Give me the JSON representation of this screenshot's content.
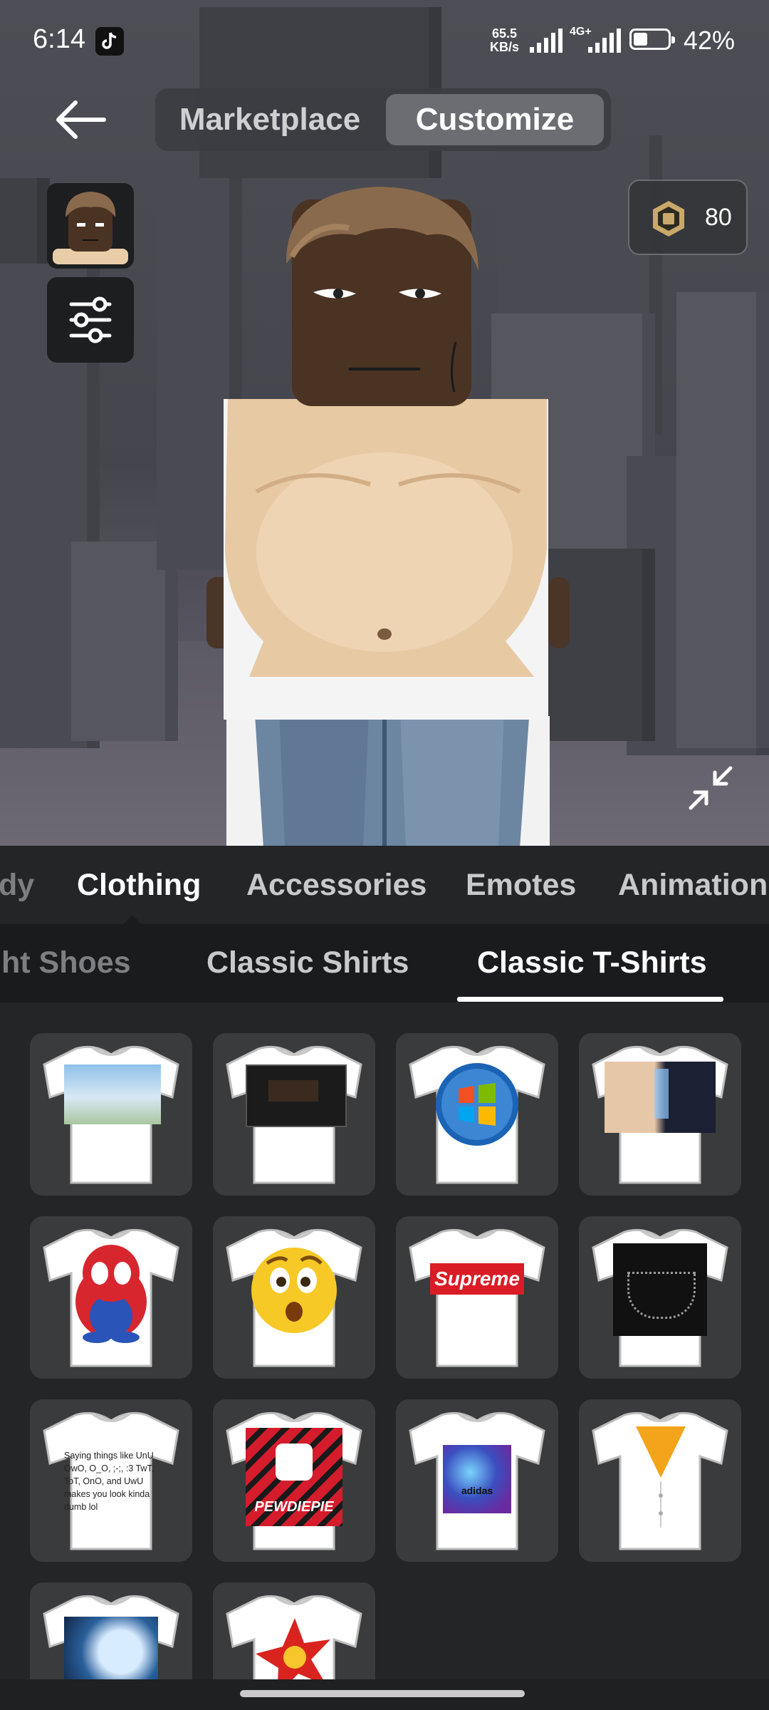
{
  "status_bar": {
    "time": "6:14",
    "net_speed_value": "65.5",
    "net_speed_unit": "KB/s",
    "network_type": "4G+",
    "battery": "42%"
  },
  "header": {
    "tabs": [
      {
        "label": "Marketplace",
        "active": false
      },
      {
        "label": "Customize",
        "active": true
      }
    ]
  },
  "robux": {
    "amount": "80"
  },
  "categories": [
    "dy",
    "Clothing",
    "Accessories",
    "Emotes",
    "Animation"
  ],
  "active_category": "Clothing",
  "subcategories": [
    "ht Shoes",
    "Classic Shirts",
    "Classic T-Shirts"
  ],
  "active_subcategory": "Classic T-Shirts",
  "items": [
    {
      "art": "parkour-scene-icon"
    },
    {
      "art": "dark-screenshot-icon"
    },
    {
      "art": "windows-logo-icon"
    },
    {
      "art": "anime-characters-icon"
    },
    {
      "art": "spider-man-penguin-icon"
    },
    {
      "art": "surprised-emoji-icon"
    },
    {
      "art": "supreme-logo-icon",
      "text": "Supreme"
    },
    {
      "art": "black-vest-chain-icon"
    },
    {
      "art": "text-shirt-icon",
      "text": "Saying things like UnU OwO, O_O, ;-;, :3 TwT, ToT, OnO, and UwU makes you look kinda dumb lol"
    },
    {
      "art": "pewdiepie-logo-icon",
      "text": "PEWDIEPIE"
    },
    {
      "art": "galaxy-adidas-icon",
      "text": "adidas"
    },
    {
      "art": "yellow-tie-icon"
    },
    {
      "art": "wolf-moon-icon"
    },
    {
      "art": "red-burst-icon"
    }
  ]
}
